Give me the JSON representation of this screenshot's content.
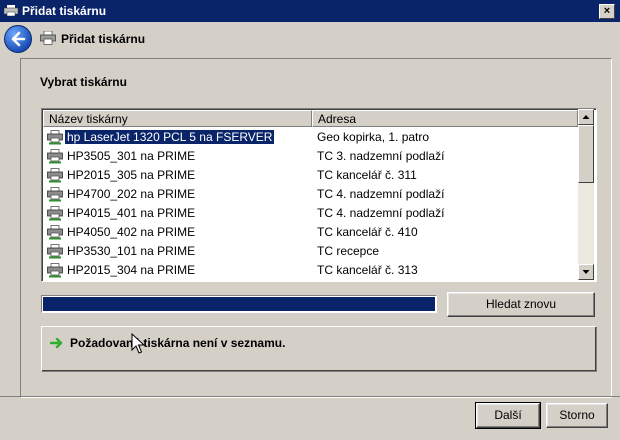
{
  "window": {
    "title": "Přidat tiskárnu",
    "close_label": "×"
  },
  "header": {
    "title": "Přidat tiskárnu"
  },
  "section": {
    "label": "Vybrat tiskárnu"
  },
  "list": {
    "columns": [
      "Název tiskárny",
      "Adresa"
    ],
    "rows": [
      {
        "name": "hp LaserJet 1320 PCL 5 na FSERVER",
        "address": "Geo kopirka, 1. patro",
        "selected": true
      },
      {
        "name": "HP3505_301 na PRIME",
        "address": "TC 3. nadzemní podlaží"
      },
      {
        "name": "HP2015_305 na PRIME",
        "address": "TC kancelář č. 311"
      },
      {
        "name": "HP4700_202 na PRIME",
        "address": "TC 4. nadzemní podlaží"
      },
      {
        "name": "HP4015_401 na PRIME",
        "address": "TC 4. nadzemní podlaží"
      },
      {
        "name": "HP4050_402 na PRIME",
        "address": "TC kancelář č. 410"
      },
      {
        "name": "HP3530_101 na PRIME",
        "address": "TC recepce"
      },
      {
        "name": "HP2015_304 na PRIME",
        "address": "TC kancelář č. 313"
      }
    ]
  },
  "progress": {
    "value_percent": 100
  },
  "buttons": {
    "search_again": "Hledat znovu",
    "next": "Další",
    "cancel": "Storno"
  },
  "not_listed": {
    "label": "Požadovaná tiskárna není v seznamu."
  },
  "colors": {
    "titlebar": "#0a246a",
    "selection": "#0a246a",
    "face": "#d4d0c8"
  }
}
